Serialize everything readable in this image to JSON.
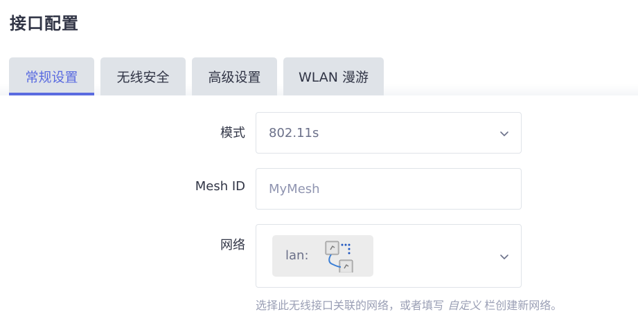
{
  "page": {
    "title": "接口配置"
  },
  "tabs": [
    {
      "label": "常规设置",
      "active": true
    },
    {
      "label": "无线安全",
      "active": false
    },
    {
      "label": "高级设置",
      "active": false
    },
    {
      "label": "WLAN 漫游",
      "active": false
    }
  ],
  "form": {
    "mode": {
      "label": "模式",
      "value": "802.11s"
    },
    "mesh_id": {
      "label": "Mesh ID",
      "value": "",
      "placeholder": "MyMesh"
    },
    "network": {
      "label": "网络",
      "chip_label": "lan:",
      "chip_icon": "network-bridge-icon",
      "help_prefix": "选择此无线接口关联的网络，或者填写 ",
      "help_emphasis": "自定义",
      "help_suffix": " 栏创建新网络。"
    }
  },
  "colors": {
    "accent": "#5a6be0",
    "tab_bg": "#dfe3e8",
    "text": "#303445",
    "muted": "#9a9fb5"
  }
}
